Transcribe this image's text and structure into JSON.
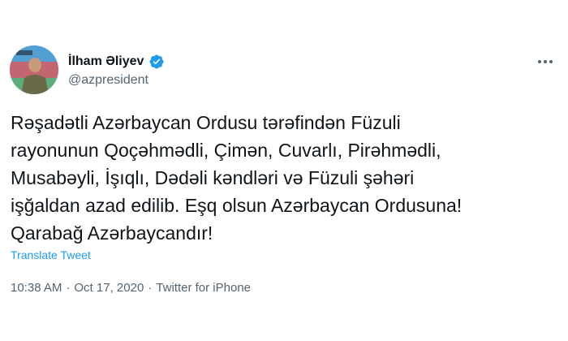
{
  "tweet": {
    "author": {
      "display_name": "İlham Əliyev",
      "handle": "@azpresident",
      "verified_icon": "verified-badge-icon",
      "avatar_icon": "profile-avatar"
    },
    "more_icon": "more-options-icon",
    "body_lines": [
      "Rəşadətli Azərbaycan Ordusu tərəfindən Füzuli",
      "rayonunun Qoçəhmədli, Çimən, Cuvarlı, Pirəhmədli,",
      "Musabəyli, İşıqlı, Dədəli kəndləri və Füzuli şəhəri",
      "işğaldan azad edilib. Eşq olsun Azərbaycan Ordusuna!",
      "Qarabağ Azərbaycandır!"
    ],
    "translate_label": "Translate Tweet",
    "time": "10:38 AM",
    "separator": "·",
    "date": "Oct 17, 2020",
    "source": "Twitter for iPhone"
  },
  "colors": {
    "text": "#0f1419",
    "secondary": "#536471",
    "link": "#1d9bf0",
    "verified": "#1d9bf0"
  }
}
